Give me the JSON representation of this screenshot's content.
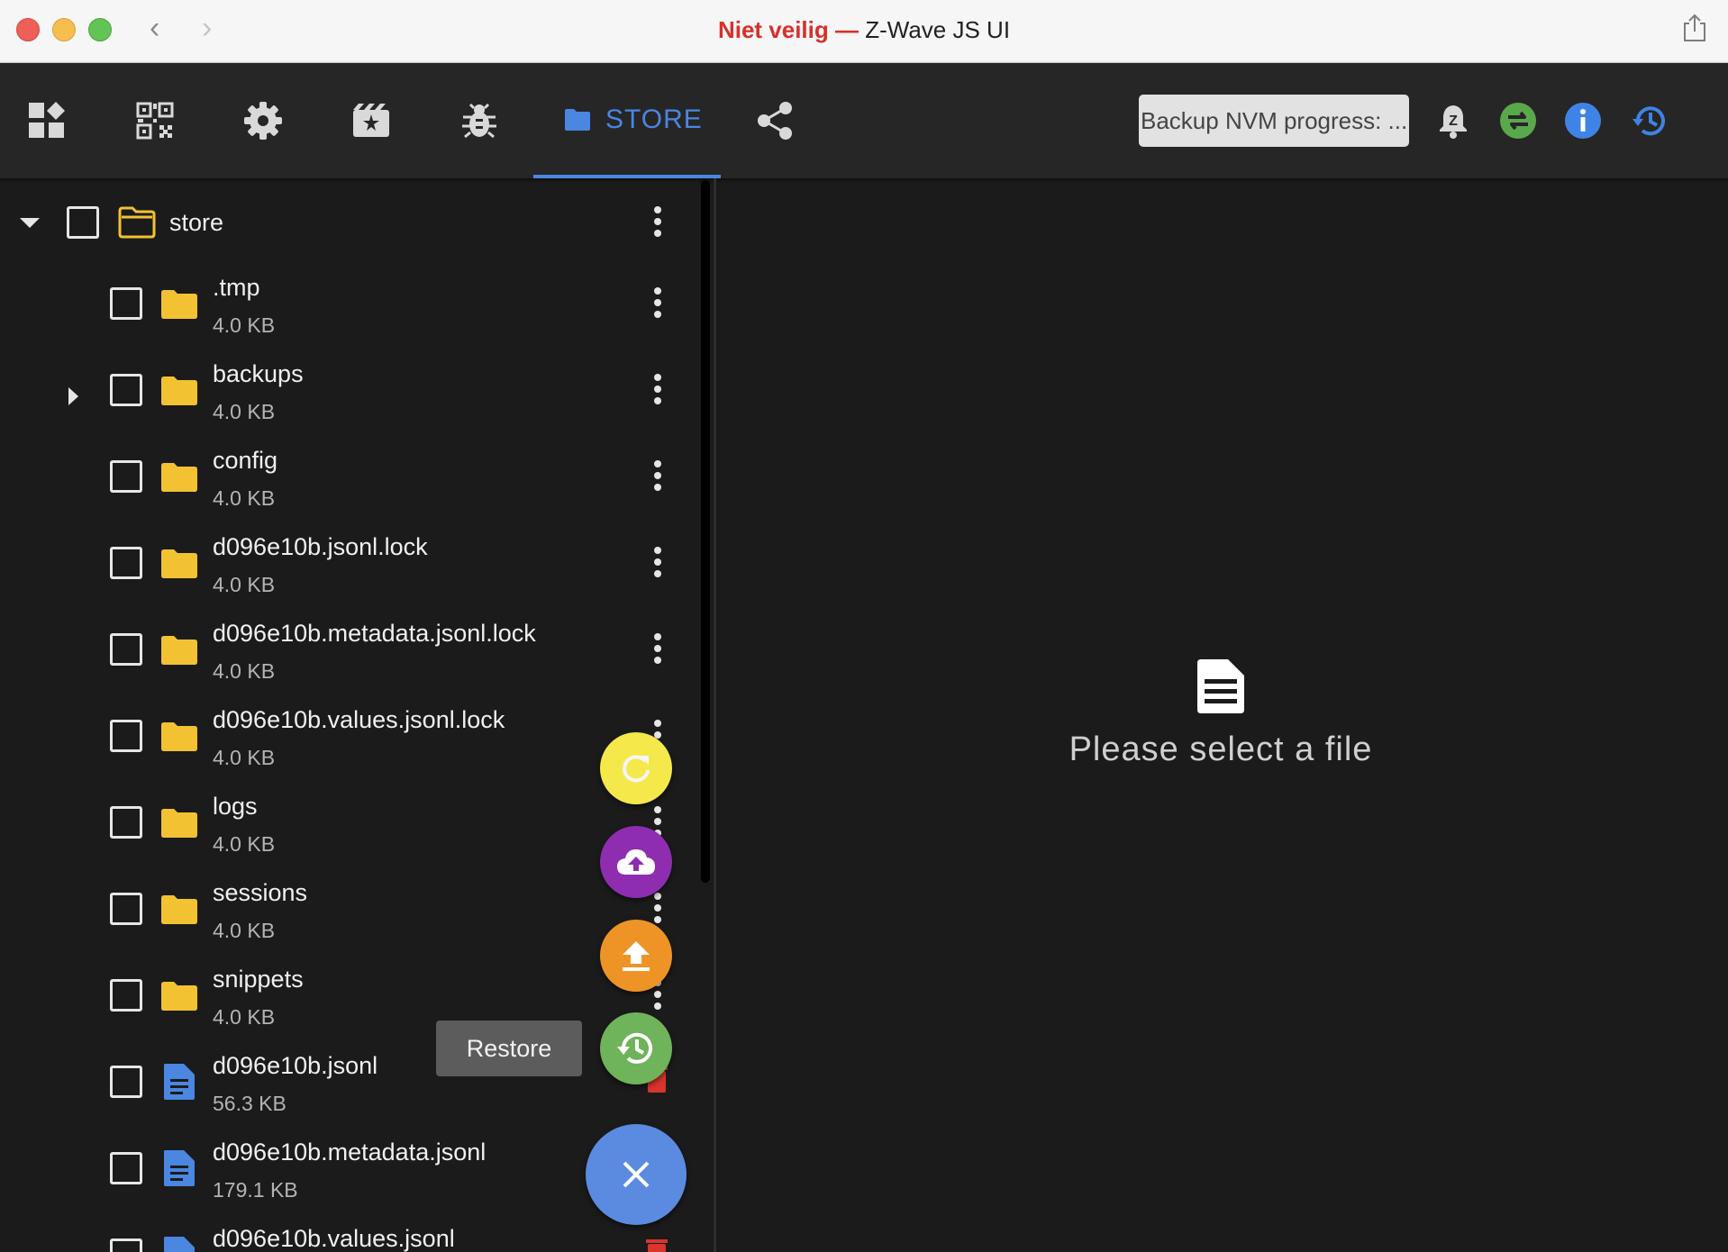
{
  "window": {
    "title_insecure": "Niet veilig",
    "title_separator": " — ",
    "title_app": "Z-Wave JS UI"
  },
  "toolbar": {
    "nav_icons": [
      "dashboard-icon",
      "qr-code-icon",
      "settings-icon",
      "smart-start-icon",
      "debug-icon"
    ],
    "active_tab": "STORE",
    "progress_label": "Backup NVM progress: ...",
    "accent_color": "#4b86e0",
    "status_icons": [
      "notification-bell-icon",
      "connection-status-icon",
      "info-icon",
      "history-icon"
    ]
  },
  "tree": {
    "root": {
      "name": "store"
    },
    "items": [
      {
        "name": ".tmp",
        "size": "4.0 KB",
        "type": "folder",
        "expandable": false
      },
      {
        "name": "backups",
        "size": "4.0 KB",
        "type": "folder",
        "expandable": true
      },
      {
        "name": "config",
        "size": "4.0 KB",
        "type": "folder",
        "expandable": false
      },
      {
        "name": "d096e10b.jsonl.lock",
        "size": "4.0 KB",
        "type": "folder",
        "expandable": false
      },
      {
        "name": "d096e10b.metadata.jsonl.lock",
        "size": "4.0 KB",
        "type": "folder",
        "expandable": false
      },
      {
        "name": "d096e10b.values.jsonl.lock",
        "size": "4.0 KB",
        "type": "folder",
        "expandable": false
      },
      {
        "name": "logs",
        "size": "4.0 KB",
        "type": "folder",
        "expandable": false
      },
      {
        "name": "sessions",
        "size": "4.0 KB",
        "type": "folder",
        "expandable": false
      },
      {
        "name": "snippets",
        "size": "4.0 KB",
        "type": "folder",
        "expandable": false
      },
      {
        "name": "d096e10b.jsonl",
        "size": "56.3 KB",
        "type": "file",
        "expandable": false
      },
      {
        "name": "d096e10b.metadata.jsonl",
        "size": "179.1 KB",
        "type": "file",
        "expandable": false
      },
      {
        "name": "d096e10b.values.jsonl",
        "size": "",
        "type": "file",
        "expandable": false
      }
    ]
  },
  "fab": {
    "tooltip": "Restore",
    "actions": [
      "refresh",
      "upload-cloud",
      "upload",
      "restore"
    ],
    "colors": {
      "refresh": "#f5e84a",
      "upload-cloud": "#8e2db0",
      "upload": "#ee9426",
      "restore": "#6fb35a",
      "close": "#5b8be0"
    }
  },
  "viewer": {
    "empty_message": "Please select a file"
  }
}
